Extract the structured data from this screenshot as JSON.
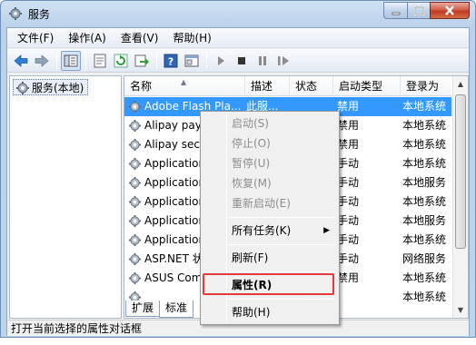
{
  "window": {
    "title": "服务"
  },
  "menubar": {
    "items": [
      "文件(F)",
      "操作(A)",
      "查看(V)",
      "帮助(H)"
    ]
  },
  "toolbar": {
    "buttons": [
      "back-arrow-icon",
      "forward-arrow-icon",
      "console-tree-icon",
      "properties-icon",
      "refresh-icon",
      "export-icon",
      "help-icon",
      "console-icon",
      "play-icon",
      "stop-icon",
      "pause-icon",
      "restart-icon"
    ]
  },
  "tree": {
    "root": "服务(本地)"
  },
  "list": {
    "columns": [
      "名称",
      "描述",
      "状态",
      "启动类型",
      "登录为"
    ],
    "rows": [
      {
        "name": "Adobe Flash Pla...",
        "desc": "此服...",
        "status": "",
        "startup": "禁用",
        "logon": "本地系统",
        "selected": true
      },
      {
        "name": "Alipay paym",
        "desc": "",
        "status": "",
        "startup": "禁用",
        "logon": "本地系统"
      },
      {
        "name": "Alipay secu",
        "desc": "",
        "status": "",
        "startup": "禁用",
        "logon": "本地系统"
      },
      {
        "name": "Application",
        "desc": "",
        "status": "",
        "startup": "手动",
        "logon": "本地系统"
      },
      {
        "name": "Application",
        "desc": "",
        "status": "",
        "startup": "手动",
        "logon": "本地服务"
      },
      {
        "name": "Application",
        "desc": "",
        "status": "",
        "startup": "手动",
        "logon": "本地系统"
      },
      {
        "name": "Application",
        "desc": "",
        "status": "",
        "startup": "手动",
        "logon": "本地服务"
      },
      {
        "name": "Application",
        "desc": "",
        "status": "",
        "startup": "手动",
        "logon": "本地系统"
      },
      {
        "name": "ASP.NET 状",
        "desc": "",
        "status": "",
        "startup": "手动",
        "logon": "网络服务"
      },
      {
        "name": "ASUS Com",
        "desc": "",
        "status": "",
        "startup": "禁用",
        "logon": "本地系统"
      },
      {
        "name": "",
        "desc": "",
        "status": "",
        "startup": "",
        "logon": "本地系统"
      }
    ]
  },
  "tabs": [
    "扩展",
    "标准"
  ],
  "status_text": "打开当前选择的属性对话框",
  "context_menu": {
    "items": [
      {
        "label": "启动(S)",
        "disabled": true
      },
      {
        "label": "停止(O)",
        "disabled": true
      },
      {
        "label": "暂停(U)",
        "disabled": true
      },
      {
        "label": "恢复(M)",
        "disabled": true
      },
      {
        "label": "重新启动(E)",
        "disabled": true
      },
      {
        "label": "所有任务(K)",
        "disabled": false,
        "submenu": true
      },
      {
        "label": "刷新(F)",
        "disabled": false
      },
      {
        "label": "属性(R)",
        "disabled": false,
        "bold": true
      },
      {
        "label": "帮助(H)",
        "disabled": false
      }
    ]
  },
  "colors": {
    "selection": "#3399ff",
    "highlight_box": "#e33b3b"
  }
}
